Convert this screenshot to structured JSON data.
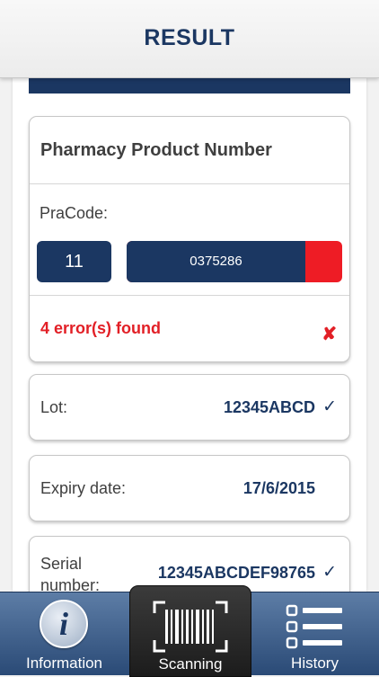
{
  "header": {
    "title": "RESULT"
  },
  "product_card": {
    "title": "Pharmacy Product Number",
    "code_label": "PraCode:",
    "code_prefix": "11",
    "code_value": "0375286",
    "error_text": "4 error(s) found",
    "error_icon": "x-mark-icon"
  },
  "fields": {
    "lot": {
      "label": "Lot:",
      "value": "12345ABCD",
      "check": "✓"
    },
    "expiry": {
      "label": "Expiry date:",
      "value": "17/6/2015"
    },
    "serial": {
      "label_line1": "Serial",
      "label_line2": "number:",
      "value": "12345ABCDEF98765",
      "check": "✓"
    }
  },
  "tabs": [
    {
      "label": "Information",
      "icon": "info-icon"
    },
    {
      "label": "Scanning",
      "icon": "barcode-scan-icon",
      "active": true
    },
    {
      "label": "History",
      "icon": "list-icon"
    }
  ],
  "colors": {
    "navy": "#1b3762",
    "error": "#e21f26",
    "tabbar": "#2a4a76"
  }
}
